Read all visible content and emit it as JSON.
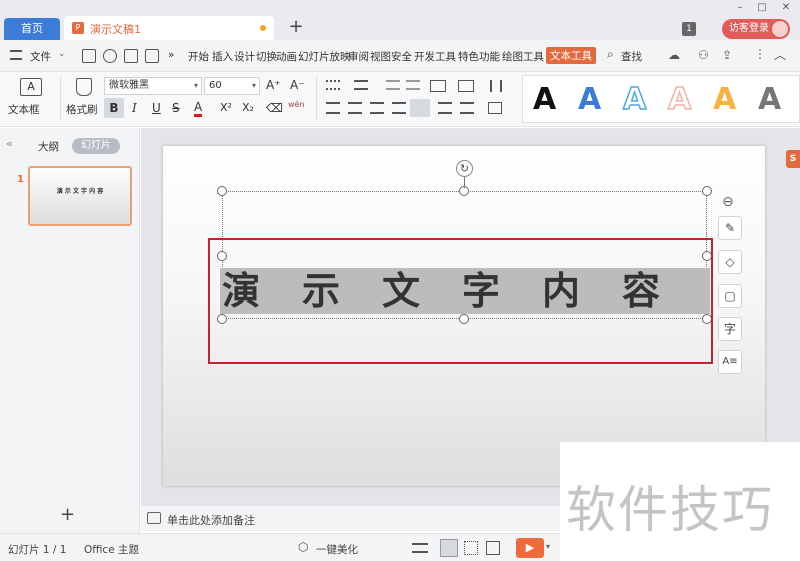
{
  "tabs": {
    "home": "首页",
    "document": "演示文稿1",
    "add": "+"
  },
  "topright": {
    "badge": "1",
    "visitor_login": "访客登录"
  },
  "window_controls": {
    "minimize": "–",
    "maximize": "□",
    "close": "✕"
  },
  "menu": {
    "file": "文件",
    "more": "»",
    "items": [
      "开始",
      "插入",
      "设计",
      "切换",
      "动画",
      "幻灯片放映",
      "审阅",
      "视图",
      "安全",
      "开发工具",
      "特色功能",
      "绘图工具"
    ],
    "active": "文本工具",
    "search": "查找"
  },
  "ribbon": {
    "textbox_label": "文本框",
    "format_painter_label": "格式刷",
    "font_name": "微软雅黑",
    "font_size": "60",
    "grow": "A⁺",
    "shrink": "A⁻",
    "bold": "B",
    "italic": "I",
    "underline": "U",
    "strike": "S",
    "fontcolor": "A",
    "superscript": "X²",
    "subscript": "X₂",
    "clear": "⌫",
    "phonetic": "wén",
    "wordart_sample": "A",
    "wordart_colors": [
      "#111111",
      "#3d7bd9",
      "#4ea6e0",
      "#f0b3a8",
      "#f5b342",
      "#777777"
    ]
  },
  "left_panel": {
    "collapse": "«",
    "outline_tab": "大纲",
    "slides_tab": "幻灯片",
    "slide_number": "1",
    "thumb_text": "演 示 文 字 内 容",
    "add_slide": "+"
  },
  "slide": {
    "text": "演　示　文　字　内　容",
    "rotate_icon": "↻"
  },
  "side_tools": {
    "minus": "⊖",
    "pen": "✎",
    "fill": "◇",
    "border": "▢",
    "char": "字",
    "effect": "A≡"
  },
  "notes": {
    "placeholder": "单击此处添加备注"
  },
  "status": {
    "slide_count": "幻灯片 1 / 1",
    "theme": "Office 主题",
    "beautify": "一键美化",
    "play": "▶"
  },
  "watermark": {
    "text": "软件技巧"
  }
}
